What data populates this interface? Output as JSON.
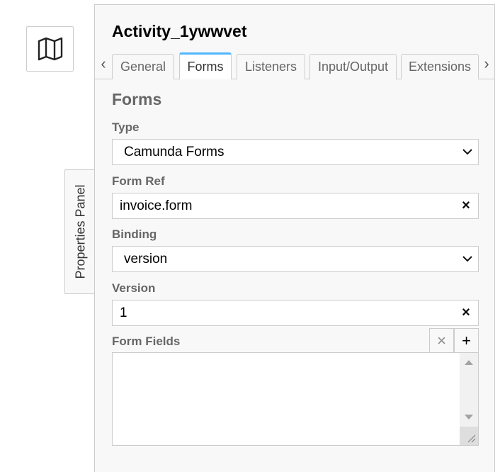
{
  "toggle": {
    "label": "Properties Panel"
  },
  "panel": {
    "element_title": "Activity_1ywwvet",
    "tabs": [
      {
        "label": "General"
      },
      {
        "label": "Forms"
      },
      {
        "label": "Listeners"
      },
      {
        "label": "Input/Output"
      },
      {
        "label": "Extensions"
      }
    ],
    "active_tab": "Forms",
    "scroll_left": "‹",
    "scroll_right": "›",
    "section_title": "Forms",
    "type": {
      "label": "Type",
      "value": "Camunda Forms"
    },
    "form_ref": {
      "label": "Form Ref",
      "value": "invoice.form"
    },
    "binding": {
      "label": "Binding",
      "value": "version"
    },
    "version": {
      "label": "Version",
      "value": "1"
    },
    "form_fields": {
      "label": "Form Fields",
      "remove": "×",
      "add": "+"
    },
    "clear_glyph": "×"
  },
  "colors": {
    "accent": "#52b5ff",
    "panel_bg": "#f8f8f8",
    "border": "#cccccc"
  },
  "icons": {
    "map": "map-icon",
    "chevron": "chevron-down-icon",
    "clear": "close-icon"
  }
}
